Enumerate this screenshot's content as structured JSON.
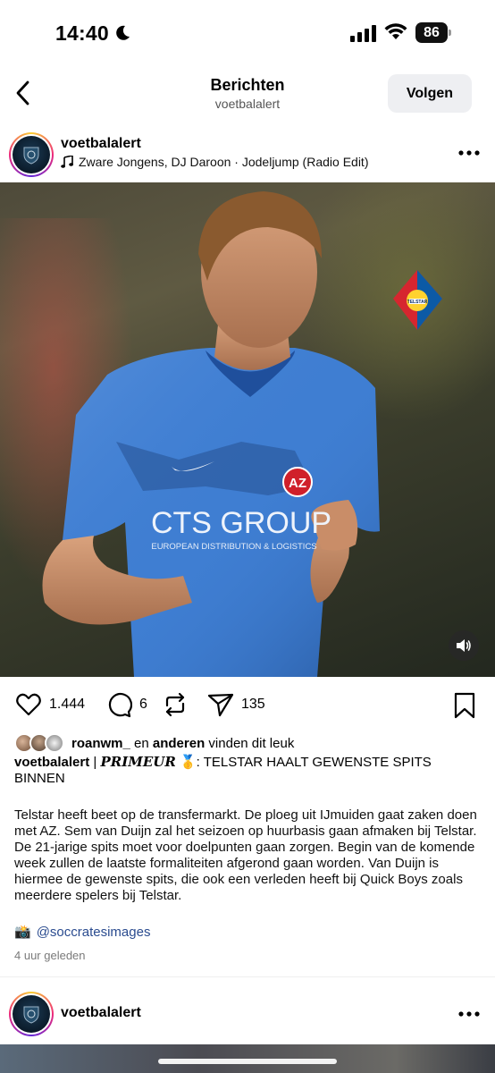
{
  "status": {
    "time": "14:40",
    "battery": "86"
  },
  "nav": {
    "title": "Berichten",
    "subtitle": "voetbalalert",
    "follow_label": "Volgen"
  },
  "post": {
    "username": "voetbalalert",
    "music": "Zware Jongens, DJ Daroon · Jodeljump (Radio Edit)",
    "media": {
      "shirt_sponsor": "CTS GROUP",
      "shirt_sub": "EUROPEAN DISTRIBUTION & LOGISTICS",
      "club_badge": "AZ",
      "overlay_badge": "TELSTAR"
    },
    "actions": {
      "likes_count": "1.444",
      "comments_count": "6",
      "shares_count": "135"
    },
    "liked_by": {
      "user": "roanwm_",
      "connector": "en",
      "others": "anderen",
      "suffix": "vinden dit leuk"
    },
    "caption": {
      "user": "voetbalalert",
      "separator": "|",
      "tag": "PRIMEUR",
      "emoji": "🥇",
      "headline": ": TELSTAR HAALT GEWENSTE SPITS BINNEN"
    },
    "body": "Telstar heeft beet op de transfermarkt. De ploeg uit IJmuiden gaat zaken doen met AZ. Sem van Duijn zal het seizoen op huurbasis gaan afmaken bij Telstar. De 21-jarige spits moet voor doelpunten gaan zorgen. Begin van de komende week zullen de laatste formaliteiten afgerond gaan worden. Van Duijn is hiermee de gewenste spits, die ook een verleden heeft bij Quick Boys zoals meerdere spelers bij Telstar.",
    "credit_emoji": "📸",
    "credit_handle": "@soccratesimages",
    "time_ago": "4 uur geleden"
  },
  "next_post": {
    "username": "voetbalalert"
  },
  "icons": {
    "back": "chevron-left-icon",
    "more": "more-horizontal-icon",
    "music": "music-note-icon",
    "like": "heart-icon",
    "comment": "comment-icon",
    "repost": "repost-icon",
    "share": "send-icon",
    "save": "bookmark-icon",
    "volume": "speaker-icon"
  },
  "colors": {
    "accent_link": "#2a4b8f",
    "follow_bg": "#eeeff2",
    "jersey": "#3f7ed2"
  }
}
